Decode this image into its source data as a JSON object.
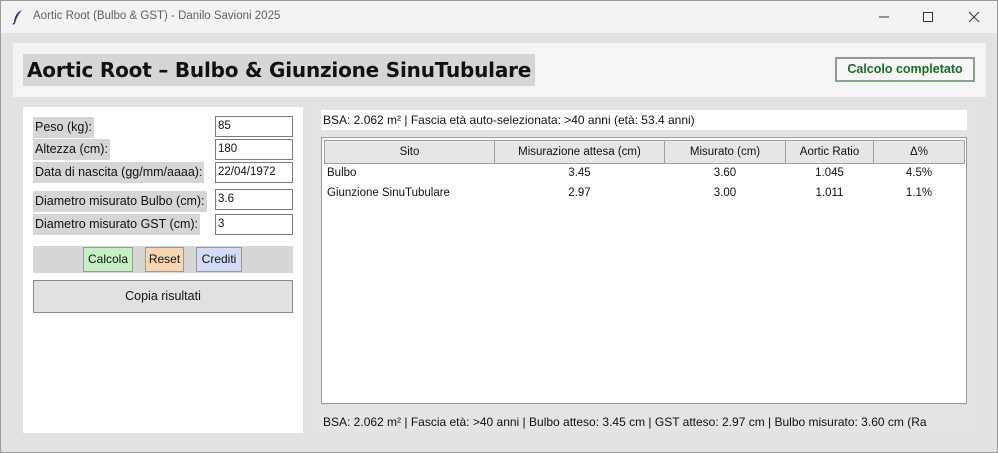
{
  "window": {
    "title": "Aortic Root (Bulbo & GST) - Danilo Savioni 2025",
    "icon": "feather-icon",
    "controls": [
      "minimize-icon",
      "maximize-icon",
      "close-icon"
    ]
  },
  "header": {
    "title": "Aortic Root – Bulbo & Giunzione SinuTubulare",
    "status": "Calcolo completato",
    "status_color": "#1d6b23"
  },
  "form": {
    "fields": [
      {
        "label": "Peso (kg):",
        "value": "85"
      },
      {
        "label": "Altezza (cm):",
        "value": "180"
      },
      {
        "label": "Data di nascita (gg/mm/aaaa):",
        "value": "22/04/1972"
      },
      {
        "label": "Diametro misurato Bulbo (cm):",
        "value": "3.6"
      },
      {
        "label": "Diametro misurato GST (cm):",
        "value": "3"
      }
    ],
    "buttons": {
      "calcola": "Calcola",
      "reset": "Reset",
      "crediti": "Crediti",
      "copia": "Copia risultati"
    },
    "button_colors": {
      "calcola": "#c4f0c4",
      "reset": "#f8d6b2",
      "crediti": "#d2dcf8"
    }
  },
  "results": {
    "bsa_line": "BSA: 2.062 m² | Fascia età auto-selezionata: >40 anni (età: 53.4 anni)",
    "columns": [
      "Sito",
      "Misurazione attesa (cm)",
      "Misurato (cm)",
      "Aortic Ratio",
      "Δ%"
    ],
    "rows": [
      [
        "Bulbo",
        "3.45",
        "3.60",
        "1.045",
        "4.5%"
      ],
      [
        "Giunzione SinuTubulare",
        "2.97",
        "3.00",
        "1.011",
        "1.1%"
      ]
    ],
    "summary": "BSA: 2.062 m² | Fascia età: >40 anni | Bulbo atteso: 3.45 cm | GST atteso: 2.97 cm | Bulbo misurato: 3.60 cm (Ra"
  }
}
